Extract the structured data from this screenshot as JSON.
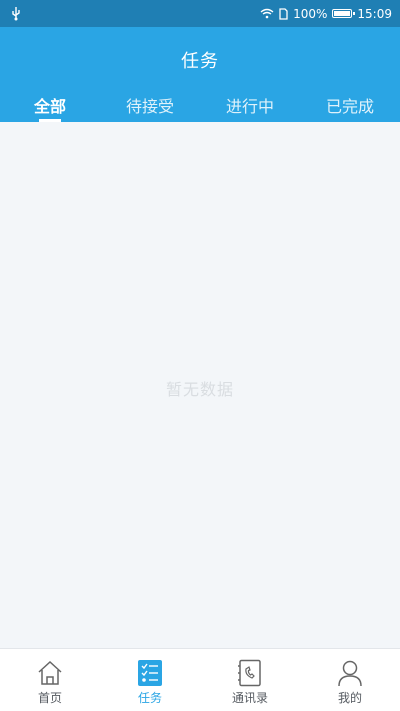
{
  "status_bar": {
    "left_icon": "usb-icon",
    "battery_text": "100%",
    "time": "15:09",
    "icons": [
      "wifi-icon",
      "sim-icon",
      "battery-icon"
    ]
  },
  "header": {
    "title": "任务",
    "background": "#2aa5e4"
  },
  "tabs": [
    {
      "label": "全部",
      "active": true
    },
    {
      "label": "待接受",
      "active": false
    },
    {
      "label": "进行中",
      "active": false
    },
    {
      "label": "已完成",
      "active": false
    }
  ],
  "main": {
    "empty_text": "暂无数据"
  },
  "bottom_nav": [
    {
      "label": "首页",
      "icon": "home-icon",
      "active": false
    },
    {
      "label": "任务",
      "icon": "task-list-icon",
      "active": true
    },
    {
      "label": "通讯录",
      "icon": "contacts-book-icon",
      "active": false
    },
    {
      "label": "我的",
      "icon": "profile-icon",
      "active": false
    }
  ],
  "colors": {
    "accent": "#2aa5e4",
    "status_bar": "#1f7fb4",
    "background": "#f3f6f9"
  }
}
